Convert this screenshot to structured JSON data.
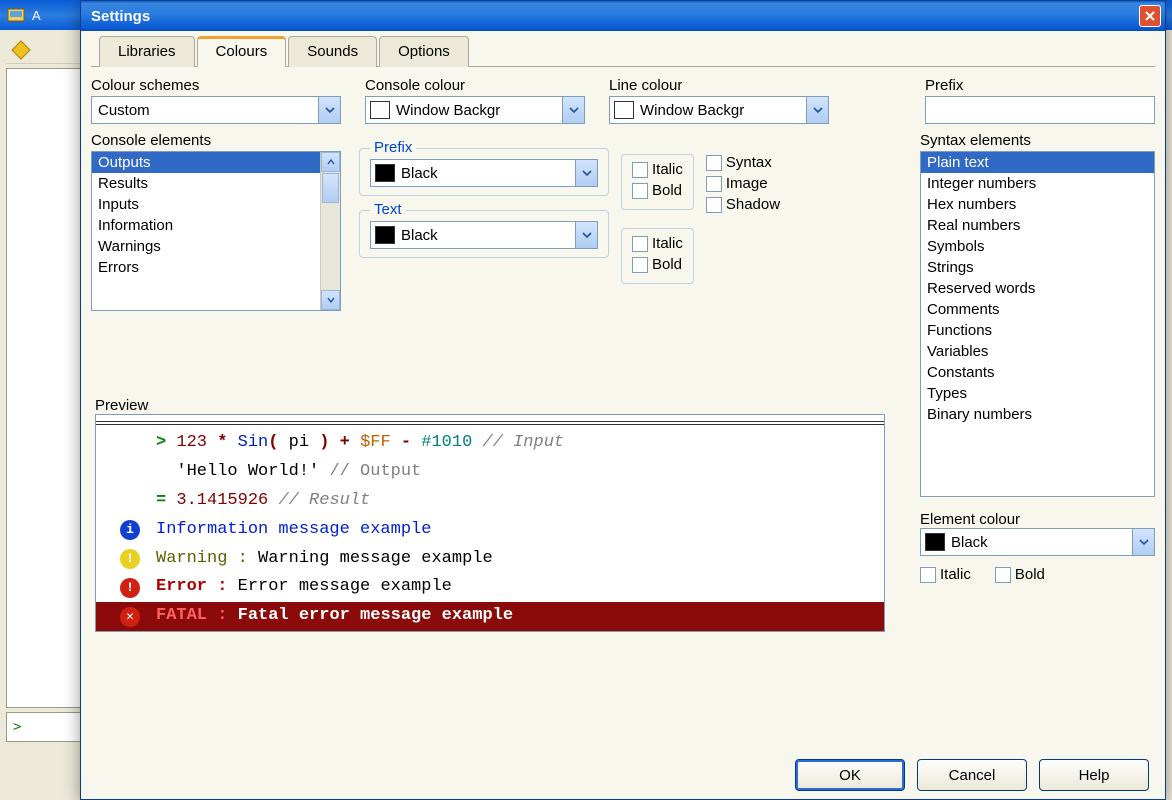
{
  "parentWindow": {
    "titleFragment": "A"
  },
  "dialog": {
    "title": "Settings",
    "tabs": [
      "Libraries",
      "Colours",
      "Sounds",
      "Options"
    ],
    "activeTab": "Colours"
  },
  "topControls": {
    "colourSchemes": {
      "label": "Colour schemes",
      "value": "Custom"
    },
    "consoleColour": {
      "label": "Console colour",
      "value": "Window Backgr"
    },
    "lineColour": {
      "label": "Line colour",
      "value": "Window Backgr"
    },
    "prefixField": {
      "label": "Prefix",
      "value": ""
    }
  },
  "consoleElements": {
    "label": "Console elements",
    "items": [
      "Outputs",
      "Results",
      "Inputs",
      "Information",
      "Warnings",
      "Errors"
    ],
    "selected": "Outputs"
  },
  "prefixGroup": {
    "legend": "Prefix",
    "value": "Black",
    "italicLabel": "Italic",
    "boldLabel": "Bold"
  },
  "textGroup": {
    "legend": "Text",
    "value": "Black",
    "italicLabel": "Italic",
    "boldLabel": "Bold"
  },
  "miscChecks": {
    "syntax": "Syntax",
    "image": "Image",
    "shadow": "Shadow"
  },
  "syntaxElements": {
    "label": "Syntax elements",
    "items": [
      "Plain text",
      "Integer numbers",
      "Hex numbers",
      "Real numbers",
      "Symbols",
      "Strings",
      "Reserved words",
      "Comments",
      "Functions",
      "Variables",
      "Constants",
      "Types",
      "Binary numbers"
    ],
    "selected": "Plain text"
  },
  "elementColour": {
    "label": "Element colour",
    "value": "Black",
    "italicLabel": "Italic",
    "boldLabel": "Bold"
  },
  "preview": {
    "label": "Preview",
    "inputLine": {
      "prompt": ">",
      "num": "123",
      "op1": "*",
      "func": "Sin",
      "lparen": "(",
      "arg": "pi",
      "rparen": ")",
      "op2": "+",
      "hex": "$FF",
      "op3": "-",
      "bin": "#1010",
      "comment": "// Input"
    },
    "outputLine": {
      "str": "'Hello World!'",
      "comment": "// Output"
    },
    "resultLine": {
      "eq": "=",
      "val": "3.1415926",
      "comment": "// Result"
    },
    "info": {
      "text": "Information message example"
    },
    "warn": {
      "label": "Warning :",
      "text": "Warning message example"
    },
    "error": {
      "label": "Error :",
      "text": "Error message example"
    },
    "fatal": {
      "label": "FATAL :",
      "text": "Fatal error message example"
    }
  },
  "buttons": {
    "ok": "OK",
    "cancel": "Cancel",
    "help": "Help"
  }
}
